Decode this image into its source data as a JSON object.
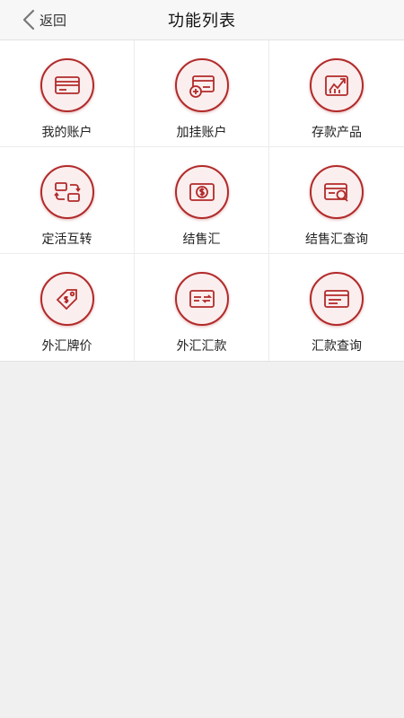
{
  "nav": {
    "back_label": "返回",
    "title": "功能列表"
  },
  "theme": {
    "accent": "#b22a2a",
    "icon_bg": "#fbeeee"
  },
  "items": [
    {
      "label": "我的账户",
      "icon": "card-icon"
    },
    {
      "label": "加挂账户",
      "icon": "card-add-icon"
    },
    {
      "label": "存款产品",
      "icon": "growth-chart-icon"
    },
    {
      "label": "定活互转",
      "icon": "transfer-cards-icon"
    },
    {
      "label": "结售汇",
      "icon": "dollar-bill-icon"
    },
    {
      "label": "结售汇查询",
      "icon": "card-search-icon"
    },
    {
      "label": "外汇牌价",
      "icon": "price-tag-icon"
    },
    {
      "label": "外汇汇款",
      "icon": "card-exchange-icon"
    },
    {
      "label": "汇款查询",
      "icon": "card-list-icon"
    }
  ]
}
